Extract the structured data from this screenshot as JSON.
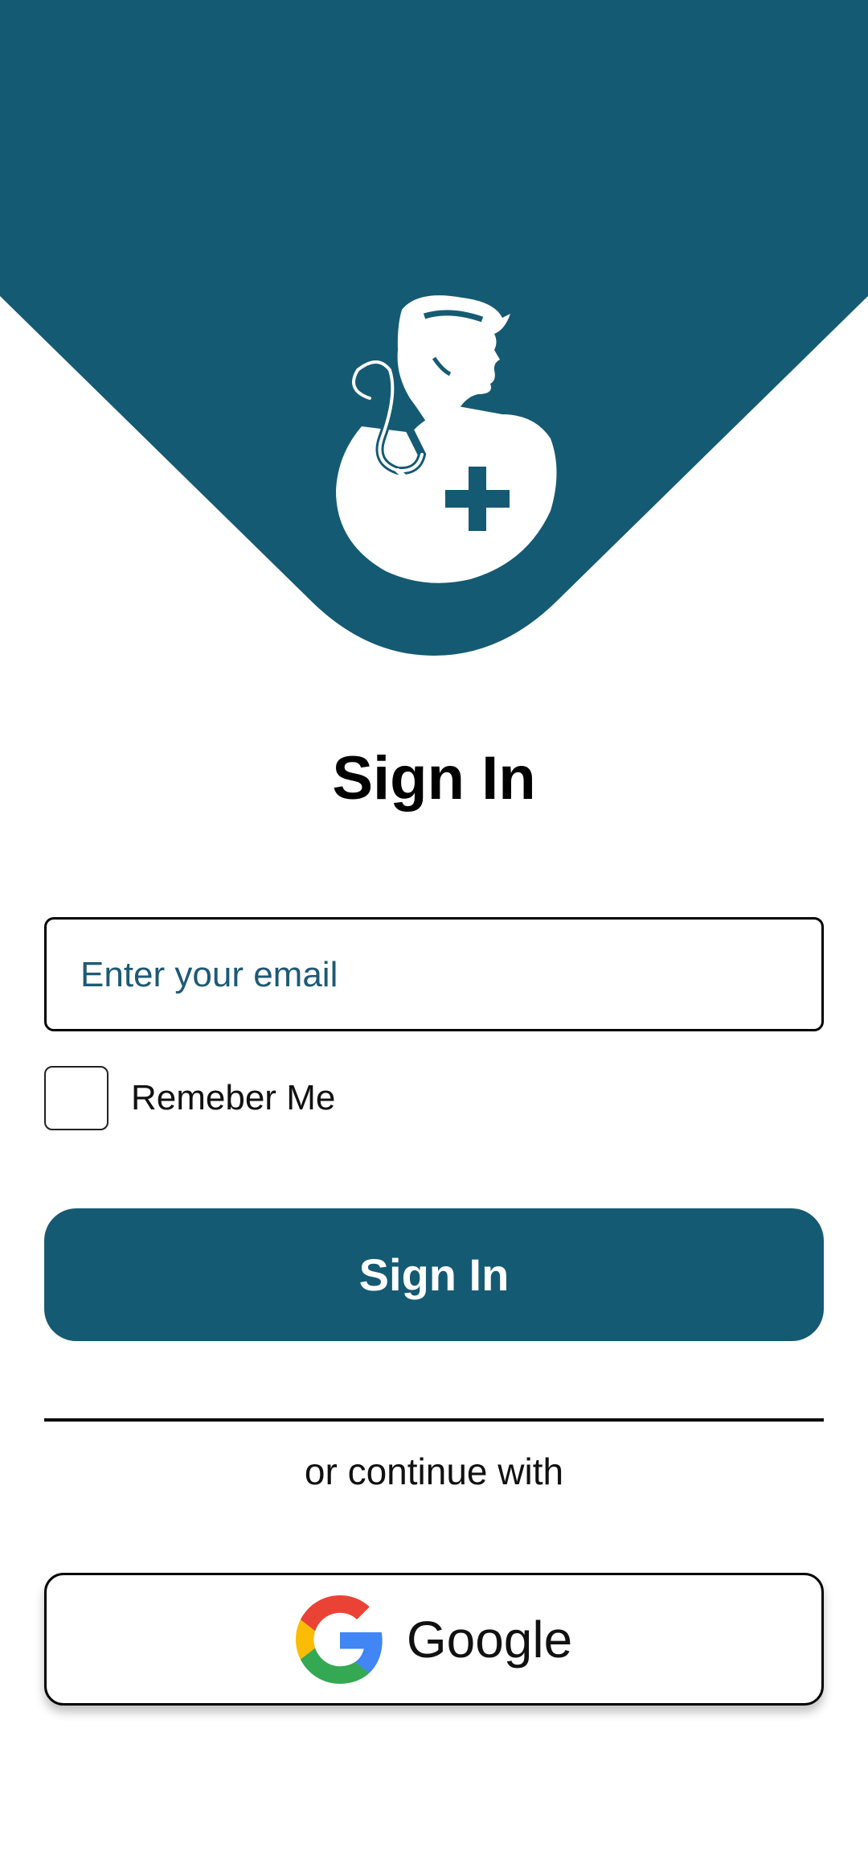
{
  "colors": {
    "brand": "#155a73",
    "background": "#ffffff",
    "text": "#000000"
  },
  "header": {
    "logo_icon": "doctor-with-stethoscope-and-cross-icon"
  },
  "form": {
    "title": "Sign In",
    "email_placeholder": "Enter your email",
    "email_value": "",
    "remember_label": "Remeber Me",
    "remember_checked": false,
    "submit_label": "Sign In"
  },
  "alt_login": {
    "divider_text": "or continue with",
    "google_label": "Google",
    "google_icon": "google-g-icon"
  }
}
